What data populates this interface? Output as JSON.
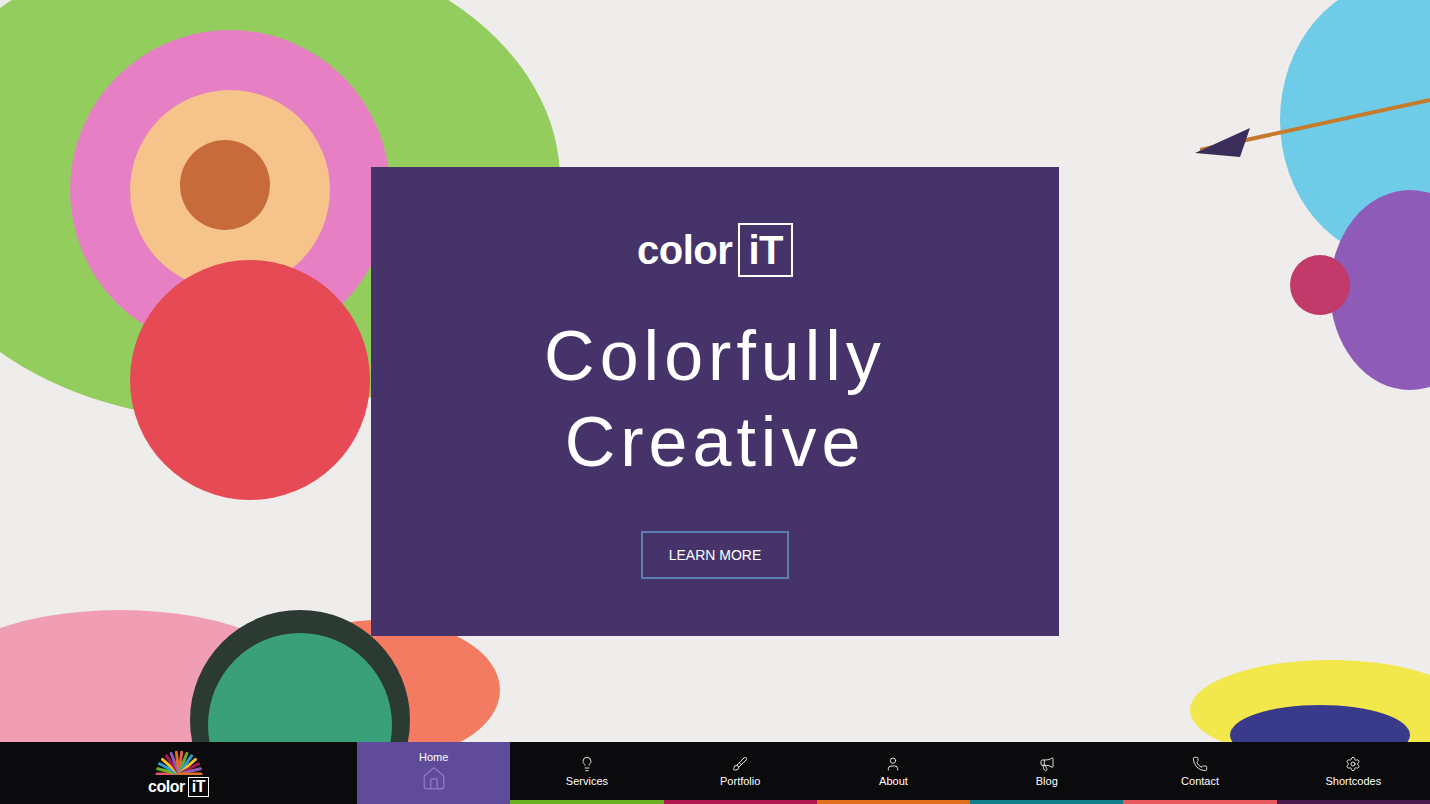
{
  "hero": {
    "logo": {
      "word": "color",
      "badge": "iT"
    },
    "headline": [
      "Colorfully",
      "Creative"
    ],
    "button": "LEARN MORE"
  },
  "nav": {
    "logo": {
      "word": "color",
      "badge": "iT"
    },
    "items": [
      {
        "label": "Home",
        "selected": true,
        "color": "#5e4b9a"
      },
      {
        "label": "Services",
        "selected": false,
        "color": "#6ab023"
      },
      {
        "label": "Portfolio",
        "selected": false,
        "color": "#b0174f"
      },
      {
        "label": "About",
        "selected": false,
        "color": "#e0701e"
      },
      {
        "label": "Blog",
        "selected": false,
        "color": "#137f8a"
      },
      {
        "label": "Contact",
        "selected": false,
        "color": "#e8585f"
      },
      {
        "label": "Shortcodes",
        "selected": false,
        "color": "#4a1a4f"
      }
    ]
  }
}
